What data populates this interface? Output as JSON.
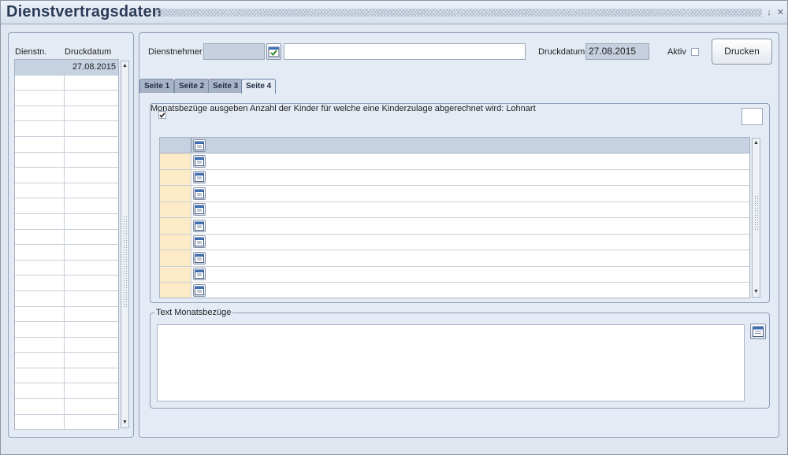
{
  "window": {
    "title": "Dienstvertragsdaten",
    "controls": [
      "↓",
      "✕"
    ]
  },
  "left_list": {
    "headers": [
      "Dienstn.",
      "Druckdatum"
    ],
    "rows": [
      {
        "dienstn": "",
        "druckdatum": "27.08.2015"
      }
    ],
    "row_count": 24
  },
  "header": {
    "dienstnehmer_label": "Dienstnehmer",
    "dienstnehmer_id": "",
    "dienstnehmer_name": "",
    "druckdatum_label": "Druckdatum",
    "druckdatum_value": "27.08.2015",
    "aktiv_label": "Aktiv",
    "aktiv_checked": false,
    "print_button": "Drucken"
  },
  "tabs": [
    {
      "label": "Seite 1",
      "active": false
    },
    {
      "label": "Seite 2",
      "active": false
    },
    {
      "label": "Seite 3",
      "active": false
    },
    {
      "label": "Seite 4",
      "active": true
    }
  ],
  "seite4": {
    "monatsbezuege_label": "Monatsbezüge ausgeben",
    "monatsbezuege_checked": true,
    "kinder_label": "Anzahl der Kinder für welche eine Kinderzulage abgerechnet wird:",
    "kinder_value": "",
    "lohnart_label": "Lohnart",
    "grid_row_count": 9,
    "text_group_label": "Text Monatsbezüge",
    "text_value": ""
  },
  "colors": {
    "accent": "#2b3a57",
    "panel": "#e5ebf4",
    "selected_row": "#c6d1e2",
    "lohnart_cell": "#fdebc7"
  }
}
